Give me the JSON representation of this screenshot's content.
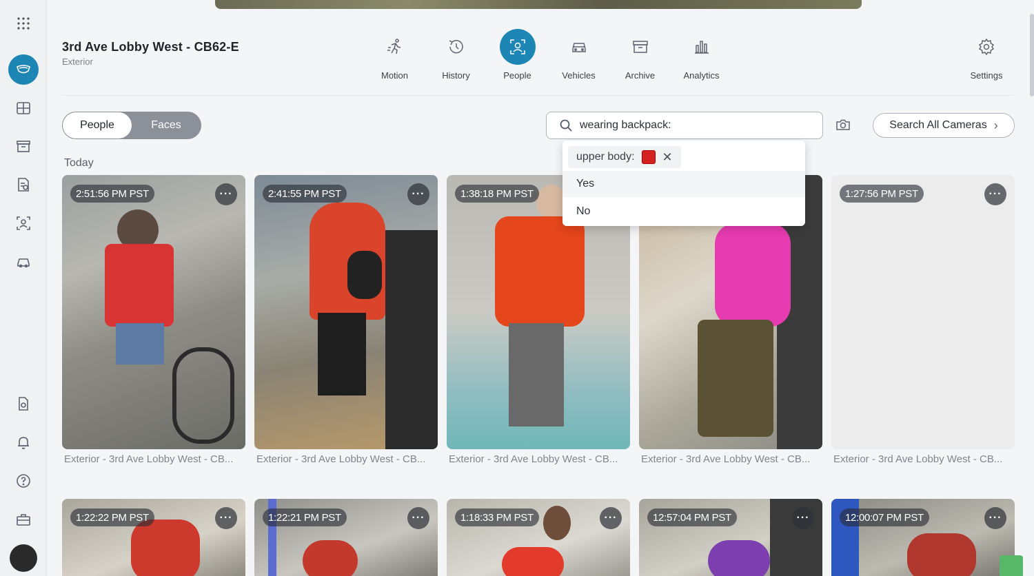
{
  "sidebar": {
    "items": [
      "apps-grid-icon",
      "cameras-icon",
      "layouts-icon",
      "archive-icon",
      "reports-icon",
      "people-icon",
      "vehicles-icon",
      "device-icon",
      "bell-icon",
      "help-icon",
      "toolbox-icon"
    ]
  },
  "camera": {
    "title": "3rd Ave Lobby West - CB62-E",
    "subtitle": "Exterior"
  },
  "nav": {
    "items": [
      {
        "label": "Motion",
        "icon": "motion-icon"
      },
      {
        "label": "History",
        "icon": "history-icon"
      },
      {
        "label": "People",
        "icon": "people-icon",
        "active": true
      },
      {
        "label": "Vehicles",
        "icon": "vehicle-icon"
      },
      {
        "label": "Archive",
        "icon": "archive-icon"
      },
      {
        "label": "Analytics",
        "icon": "analytics-icon"
      }
    ],
    "settings_label": "Settings"
  },
  "toggle": {
    "people": "People",
    "faces": "Faces"
  },
  "search": {
    "value": "wearing backpack:",
    "search_all_label": "Search All Cameras"
  },
  "dropdown": {
    "chip_label": "upper body:",
    "chip_color": "#d42020",
    "options": [
      "Yes",
      "No"
    ]
  },
  "section_label": "Today",
  "cards": [
    {
      "time": "2:51:56 PM PST",
      "caption": "Exterior - 3rd Ave Lobby West - CB..."
    },
    {
      "time": "2:41:55 PM PST",
      "caption": "Exterior - 3rd Ave Lobby West - CB..."
    },
    {
      "time": "1:38:18 PM PST",
      "caption": "Exterior - 3rd Ave Lobby West - CB..."
    },
    {
      "time": "",
      "caption": "Exterior - 3rd Ave Lobby West - CB..."
    },
    {
      "time": "1:27:56 PM PST",
      "caption": "Exterior - 3rd Ave Lobby West - CB..."
    },
    {
      "time": "1:22:22 PM PST",
      "caption": ""
    },
    {
      "time": "1:22:21 PM PST",
      "caption": ""
    },
    {
      "time": "1:18:33 PM PST",
      "caption": ""
    },
    {
      "time": "12:57:04 PM PST",
      "caption": ""
    },
    {
      "time": "12:00:07 PM PST",
      "caption": ""
    }
  ],
  "colors": {
    "accent": "#1d86b5"
  }
}
